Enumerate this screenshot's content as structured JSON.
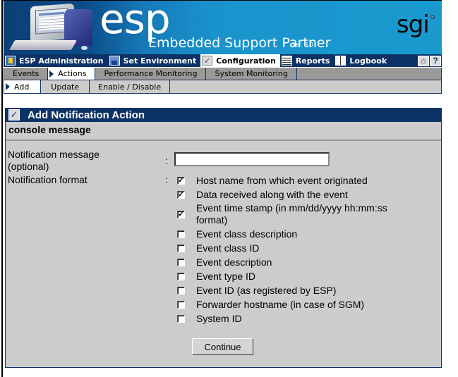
{
  "banner": {
    "logo_text": "esp",
    "product_name": "Embedded Support Partner",
    "version": "ver. 3.0",
    "company_logo": "sgi"
  },
  "nav_primary": {
    "tabs": [
      {
        "label": "ESP Administration",
        "icon": "admin-icon",
        "active": false
      },
      {
        "label": "Set Environment",
        "icon": "environment-icon",
        "active": false
      },
      {
        "label": "Configuration",
        "icon": "checkmark-icon",
        "active": true
      },
      {
        "label": "Reports",
        "icon": "table-icon",
        "active": false
      },
      {
        "label": "Logbook",
        "icon": "book-icon",
        "active": false
      }
    ],
    "home_icon": "⌂",
    "help_icon": "?"
  },
  "nav_secondary": {
    "tabs": [
      {
        "label": "Events",
        "active": false
      },
      {
        "label": "Actions",
        "active": true
      },
      {
        "label": "Performance Monitoring",
        "active": false
      },
      {
        "label": "System Monitoring",
        "active": false
      }
    ]
  },
  "nav_tertiary": {
    "tabs": [
      {
        "label": "Add",
        "active": true
      },
      {
        "label": "Update",
        "active": false
      },
      {
        "label": "Enable / Disable",
        "active": false
      }
    ]
  },
  "panel": {
    "title": "Add Notification Action",
    "subtitle": "console message",
    "message_label_line1": "Notification message",
    "message_label_line2": "(optional)",
    "message_value": "",
    "format_label": "Notification format",
    "colon": ":",
    "options": [
      {
        "label": "Host name from which event originated",
        "checked": true
      },
      {
        "label": "Data received along with the event",
        "checked": true
      },
      {
        "label_line1": "Event time stamp (in mm/dd/yyyy hh:mm:ss",
        "label_line2": "format)",
        "checked": true
      },
      {
        "label": "Event class description",
        "checked": false
      },
      {
        "label": "Event class ID",
        "checked": false
      },
      {
        "label": "Event description",
        "checked": false
      },
      {
        "label": "Event type ID",
        "checked": false
      },
      {
        "label": "Event ID (as registered by ESP)",
        "checked": false
      },
      {
        "label": "Forwarder hostname (in case of SGM)",
        "checked": false
      },
      {
        "label": "System ID",
        "checked": false
      }
    ],
    "continue_label": "Continue"
  }
}
